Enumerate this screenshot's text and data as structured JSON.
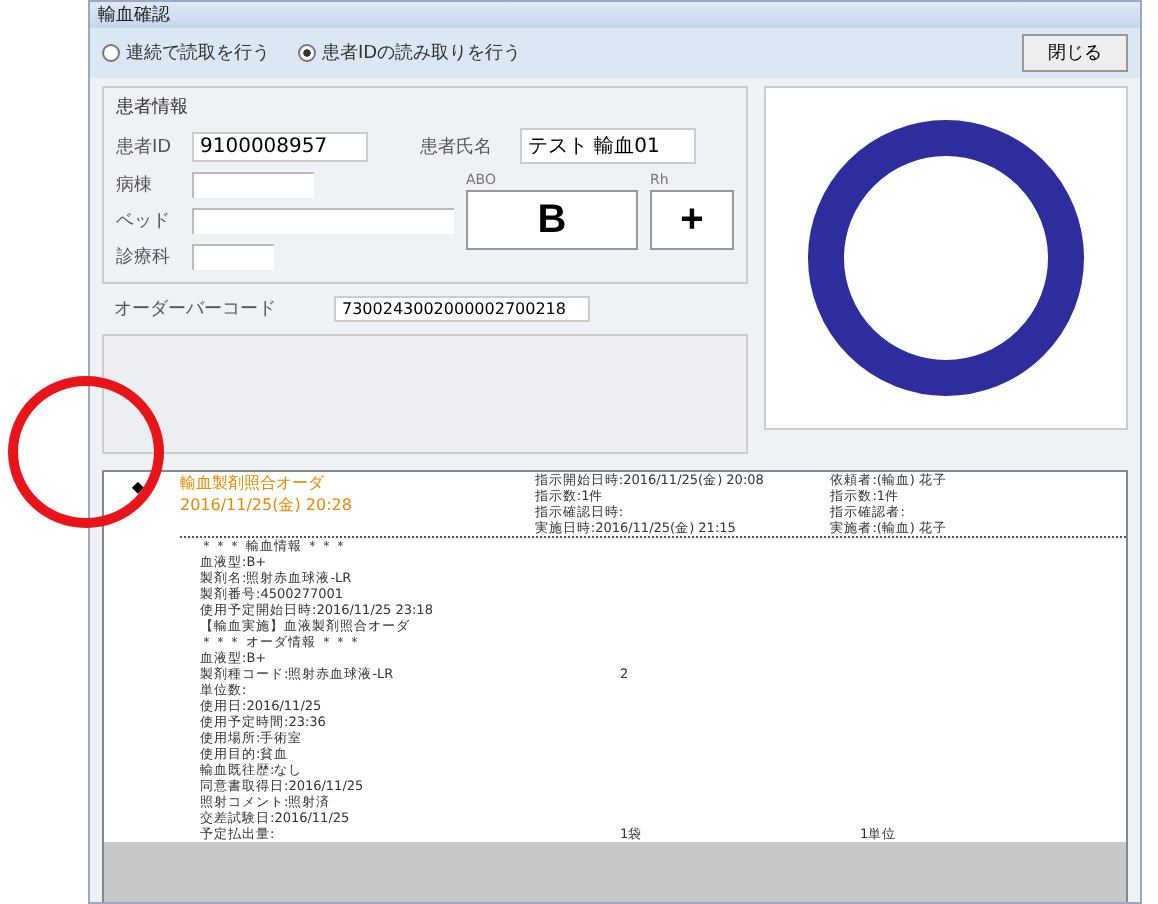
{
  "window": {
    "title": "輸血確認"
  },
  "modes": [
    {
      "label": "連続で読取を行う",
      "selected": false
    },
    {
      "label": "患者IDの読み取りを行う",
      "selected": true
    }
  ],
  "close_button": "閉じる",
  "patient": {
    "group_title": "患者情報",
    "id_label": "患者ID",
    "id": "9100008957",
    "name_label": "患者氏名",
    "name": "テスト 輸血01",
    "fields": [
      {
        "label": "病棟"
      },
      {
        "label": "ベッド"
      },
      {
        "label": "診療科"
      }
    ],
    "abo_label": "ABO",
    "abo": "B",
    "rh_label": "Rh",
    "rh": "+"
  },
  "order_barcode": {
    "label": "オーダーバーコード",
    "value": "7300243002000002700218"
  },
  "record": {
    "marker": "◆",
    "title": "輸血製剤照合オーダ",
    "date": "2016/11/25(金) 20:28",
    "info_left": [
      "指示開始日時:2016/11/25(金) 20:08",
      "指示数:1件",
      "指示確認日時:",
      "実施日時:2016/11/25(金) 21:15"
    ],
    "info_right": [
      "依頼者:(輸血) 花子",
      "指示数:1件",
      "指示確認者:",
      "実施者:(輸血) 花子"
    ],
    "lines": [
      {
        "text": "＊＊＊ 輸血情報 ＊＊＊"
      },
      {
        "text": "血液型:B+"
      },
      {
        "text": "製剤名:照射赤血球液-LR"
      },
      {
        "text": "製剤番号:4500277001"
      },
      {
        "text": "使用予定開始日時:2016/11/25 23:18"
      },
      {
        "text": "【輸血実施】血液製剤照合オーダ"
      },
      {
        "text": "＊＊＊ オーダ情報 ＊＊＊"
      },
      {
        "text": "血液型:B+"
      },
      {
        "text": "製剤種コード:照射赤血球液-LR",
        "qty": "2"
      },
      {
        "text": "単位数:"
      },
      {
        "text": "使用日:2016/11/25"
      },
      {
        "text": "使用予定時間:23:36"
      },
      {
        "text": "使用場所:手術室"
      },
      {
        "text": "使用目的:貧血"
      },
      {
        "text": "輸血既往歴:なし"
      },
      {
        "text": "同意書取得日:2016/11/25"
      },
      {
        "text": "照射コメント:照射済"
      },
      {
        "text": "交差試験日:2016/11/25"
      },
      {
        "text": "予定払出量:",
        "qty": "1袋",
        "unit": "1単位"
      }
    ]
  }
}
